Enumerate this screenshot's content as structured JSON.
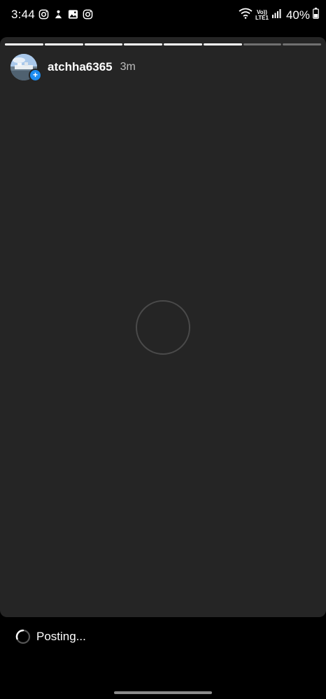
{
  "status_bar": {
    "time": "3:44",
    "left_icons": [
      "instagram-icon",
      "threads-icon",
      "gallery-icon",
      "instagram-icon"
    ],
    "right_icons": [
      "wifi-icon",
      "volte-lte-icon",
      "signal-icon",
      "battery-icon"
    ],
    "lte_top": "Vo))",
    "lte_bottom": "LTE1",
    "battery": "40%"
  },
  "story": {
    "segments": [
      {
        "progress": 1.0
      },
      {
        "progress": 1.0
      },
      {
        "progress": 1.0
      },
      {
        "progress": 1.0
      },
      {
        "progress": 1.0
      },
      {
        "progress": 1.0
      },
      {
        "progress": 0.0
      },
      {
        "progress": 0.0
      }
    ],
    "username": "atchha6365",
    "time_ago": "3m",
    "avatar_badge": "+"
  },
  "footer": {
    "posting_label": "Posting..."
  },
  "colors": {
    "background": "#000000",
    "story_bg": "#252525",
    "accent_blue": "#1d8cf0",
    "muted_text": "#bdbdbd"
  }
}
